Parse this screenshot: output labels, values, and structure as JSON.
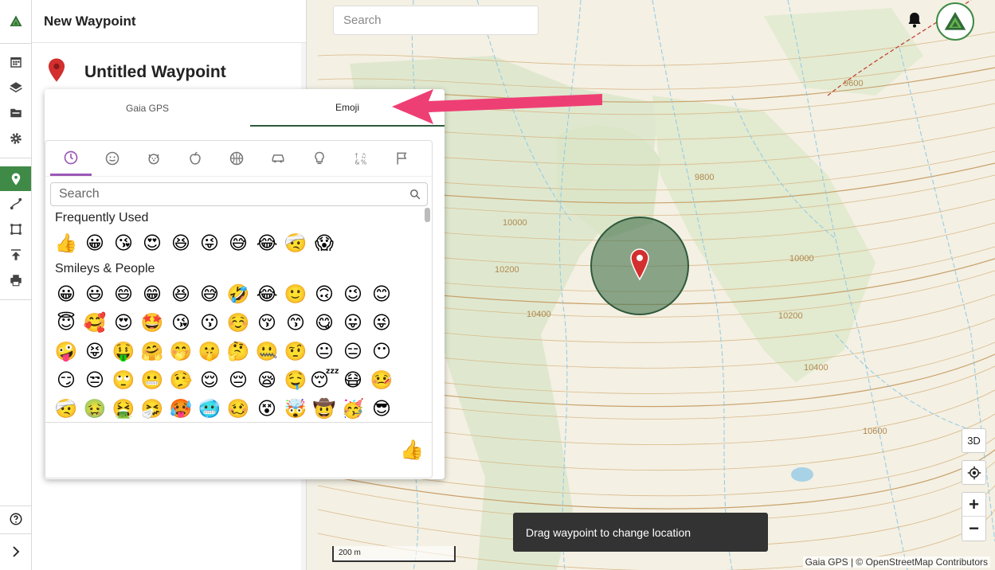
{
  "panel": {
    "title": "New Waypoint",
    "waypoint_title": "Untitled Waypoint"
  },
  "picker": {
    "tabs": [
      {
        "label": "Gaia GPS",
        "selected": false
      },
      {
        "label": "Emoji",
        "selected": true
      }
    ],
    "categories": [
      {
        "icon": "clock-icon",
        "selected": true
      },
      {
        "icon": "smiley-icon",
        "selected": false
      },
      {
        "icon": "dog-icon",
        "selected": false
      },
      {
        "icon": "apple-icon",
        "selected": false
      },
      {
        "icon": "basketball-icon",
        "selected": false
      },
      {
        "icon": "car-icon",
        "selected": false
      },
      {
        "icon": "lightbulb-icon",
        "selected": false
      },
      {
        "icon": "symbols-icon",
        "selected": false
      },
      {
        "icon": "flags-icon",
        "selected": false
      }
    ],
    "search_placeholder": "Search",
    "frequently_used_title": "Frequently Used",
    "frequently_used": [
      "👍",
      "😀",
      "😘",
      "😍",
      "😆",
      "😜",
      "😅",
      "😂",
      "🤕",
      "😱"
    ],
    "smileys_title": "Smileys & People",
    "smileys_rows": [
      [
        "😀",
        "😃",
        "😄",
        "😁",
        "😆",
        "😅",
        "🤣",
        "😂",
        "🙂",
        "🙃",
        "😉",
        "😊"
      ],
      [
        "😇",
        "🥰",
        "😍",
        "🤩",
        "😘",
        "😗",
        "☺️",
        "😚",
        "😙",
        "😋",
        "😛",
        "😜"
      ],
      [
        "🤪",
        "😝",
        "🤑",
        "🤗",
        "🤭",
        "🤫",
        "🤔",
        "🤐",
        "🤨",
        "😐",
        "😑",
        "😶"
      ],
      [
        "😏",
        "😒",
        "🙄",
        "😬",
        "🤥",
        "😌",
        "😔",
        "😪",
        "🤤",
        "😴",
        "😷",
        "🤒"
      ],
      [
        "🤕",
        "🤢",
        "🤮",
        "🤧",
        "🥵",
        "🥶",
        "🥴",
        "😵",
        "🤯",
        "🤠",
        "🥳",
        "😎"
      ]
    ],
    "preview_emoji": "👍"
  },
  "map": {
    "search_placeholder": "Search",
    "toast": "Drag waypoint to change location",
    "attribution": "Gaia GPS | © OpenStreetMap Contributors",
    "scale_label": "200 m",
    "btn_3d": "3D",
    "zoom_in": "+",
    "zoom_out": "−",
    "contour_labels": [
      "9600",
      "9800",
      "10000",
      "10200",
      "10400",
      "10000",
      "10200",
      "10400",
      "10600",
      "9600"
    ]
  },
  "colors": {
    "accent": "#3f8a46",
    "arrow": "#ee3f74",
    "category_highlight": "#9b59b6",
    "marker": "#d32f2f"
  }
}
